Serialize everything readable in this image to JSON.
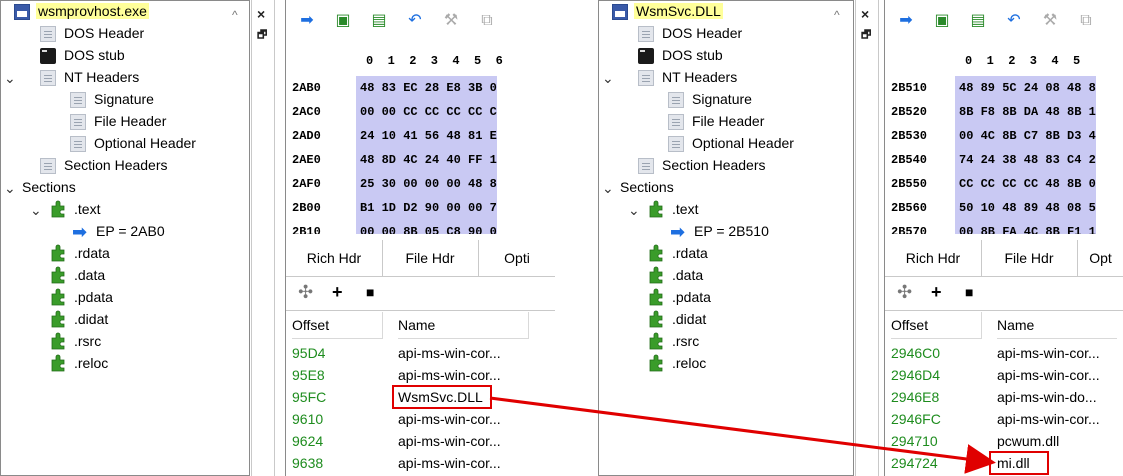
{
  "left": {
    "title": "wsmprovhost.exe",
    "tree": {
      "dos_header": "DOS Header",
      "dos_stub": "DOS stub",
      "nt_headers": "NT Headers",
      "signature": "Signature",
      "file_header": "File Header",
      "optional_header": "Optional Header",
      "section_headers": "Section Headers",
      "sections": "Sections",
      "text": ".text",
      "ep": "EP = 2AB0",
      "rdata": ".rdata",
      "data": ".data",
      "pdata": ".pdata",
      "didat": ".didat",
      "rsrc": ".rsrc",
      "reloc": ".reloc"
    },
    "hex": {
      "header": "0  1  2  3  4  5  6",
      "rows": [
        {
          "offset": "2AB0",
          "bytes": "48 83 EC 28 E8 3B 0"
        },
        {
          "offset": "2AC0",
          "bytes": "00 00 CC CC CC CC C"
        },
        {
          "offset": "2AD0",
          "bytes": "24 10 41 56 48 81 E"
        },
        {
          "offset": "2AE0",
          "bytes": "48 8D 4C 24 40 FF 1"
        },
        {
          "offset": "2AF0",
          "bytes": "25 30 00 00 00 48 8"
        },
        {
          "offset": "2B00",
          "bytes": "B1 1D D2 90 00 00 7"
        },
        {
          "offset": "2B10",
          "bytes": "00 00 8B 05 C8 90 0"
        }
      ]
    },
    "tabs": [
      "Rich Hdr",
      "File Hdr",
      "Opti"
    ],
    "table": {
      "col_offset": "Offset",
      "col_name": "Name",
      "rows": [
        {
          "offset": "95D4",
          "name": "api-ms-win-cor..."
        },
        {
          "offset": "95E8",
          "name": "api-ms-win-cor..."
        },
        {
          "offset": "95FC",
          "name": "WsmSvc.DLL"
        },
        {
          "offset": "9610",
          "name": "api-ms-win-cor..."
        },
        {
          "offset": "9624",
          "name": "api-ms-win-cor..."
        },
        {
          "offset": "9638",
          "name": "api-ms-win-cor..."
        }
      ]
    }
  },
  "right": {
    "title": "WsmSvc.DLL",
    "tree": {
      "dos_header": "DOS Header",
      "dos_stub": "DOS stub",
      "nt_headers": "NT Headers",
      "signature": "Signature",
      "file_header": "File Header",
      "optional_header": "Optional Header",
      "section_headers": "Section Headers",
      "sections": "Sections",
      "text": ".text",
      "ep": "EP = 2B510",
      "rdata": ".rdata",
      "data": ".data",
      "pdata": ".pdata",
      "didat": ".didat",
      "rsrc": ".rsrc",
      "reloc": ".reloc"
    },
    "hex": {
      "header": "0  1  2  3  4  5",
      "rows": [
        {
          "offset": "2B510",
          "bytes": "48 89 5C 24 08 48 8"
        },
        {
          "offset": "2B520",
          "bytes": "8B F8 8B DA 48 8B 1"
        },
        {
          "offset": "2B530",
          "bytes": "00 4C 8B C7 8B D3 4"
        },
        {
          "offset": "2B540",
          "bytes": "74 24 38 48 83 C4 2"
        },
        {
          "offset": "2B550",
          "bytes": "CC CC CC CC 48 8B 0"
        },
        {
          "offset": "2B560",
          "bytes": "50 10 48 89 48 08 5"
        },
        {
          "offset": "2B570",
          "bytes": "00 8B FA 4C 8B F1 1"
        }
      ]
    },
    "tabs": [
      "Rich Hdr",
      "File Hdr",
      "Opt"
    ],
    "table": {
      "col_offset": "Offset",
      "col_name": "Name",
      "rows": [
        {
          "offset": "2946C0",
          "name": "api-ms-win-cor..."
        },
        {
          "offset": "2946D4",
          "name": "api-ms-win-cor..."
        },
        {
          "offset": "2946E8",
          "name": "api-ms-win-do..."
        },
        {
          "offset": "2946FC",
          "name": "api-ms-win-cor..."
        },
        {
          "offset": "294710",
          "name": "pcwum.dll"
        },
        {
          "offset": "294724",
          "name": "mi.dll"
        }
      ]
    }
  },
  "vbar": {
    "close": "×",
    "pin": "🗗"
  },
  "colors": {
    "highlight": "#ffff9a",
    "offset_green": "#1e8c1e",
    "hex_bg": "#c9c9f3",
    "annotation_red": "#e00000"
  }
}
